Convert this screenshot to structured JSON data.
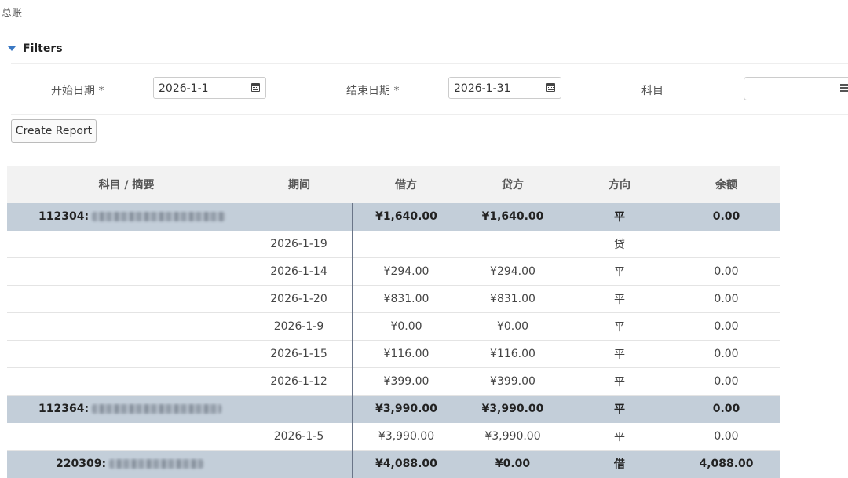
{
  "page": {
    "title": "总账"
  },
  "filters": {
    "title": "Filters",
    "start_label": "开始日期 *",
    "start_value": "2026-1-1",
    "end_label": "结束日期 *",
    "end_value": "2026-1-31",
    "subject_label": "科目",
    "subject_value": ""
  },
  "create_button": "Create Report",
  "table": {
    "headers": [
      "科目 / 摘要",
      "期间",
      "借方",
      "贷方",
      "方向",
      "余额"
    ],
    "rows": [
      {
        "type": "group",
        "code": "112304:",
        "period": "",
        "debit": "¥1,640.00",
        "credit": "¥1,640.00",
        "dir": "平",
        "balance": "0.00"
      },
      {
        "type": "detail",
        "code": "",
        "period": "2026-1-19",
        "debit": "",
        "credit": "",
        "dir": "贷",
        "balance": ""
      },
      {
        "type": "detail",
        "code": "",
        "period": "2026-1-14",
        "debit": "¥294.00",
        "credit": "¥294.00",
        "dir": "平",
        "balance": "0.00"
      },
      {
        "type": "detail",
        "code": "",
        "period": "2026-1-20",
        "debit": "¥831.00",
        "credit": "¥831.00",
        "dir": "平",
        "balance": "0.00"
      },
      {
        "type": "detail",
        "code": "",
        "period": "2026-1-9",
        "debit": "¥0.00",
        "credit": "¥0.00",
        "dir": "平",
        "balance": "0.00"
      },
      {
        "type": "detail",
        "code": "",
        "period": "2026-1-15",
        "debit": "¥116.00",
        "credit": "¥116.00",
        "dir": "平",
        "balance": "0.00"
      },
      {
        "type": "detail",
        "code": "",
        "period": "2026-1-12",
        "debit": "¥399.00",
        "credit": "¥399.00",
        "dir": "平",
        "balance": "0.00"
      },
      {
        "type": "group",
        "code": "112364:",
        "period": "",
        "debit": "¥3,990.00",
        "credit": "¥3,990.00",
        "dir": "平",
        "balance": "0.00"
      },
      {
        "type": "detail",
        "code": "",
        "period": "2026-1-5",
        "debit": "¥3,990.00",
        "credit": "¥3,990.00",
        "dir": "平",
        "balance": "0.00"
      },
      {
        "type": "group",
        "code": "220309:",
        "period": "",
        "debit": "¥4,088.00",
        "credit": "¥0.00",
        "dir": "借",
        "balance": "4,088.00"
      }
    ]
  }
}
